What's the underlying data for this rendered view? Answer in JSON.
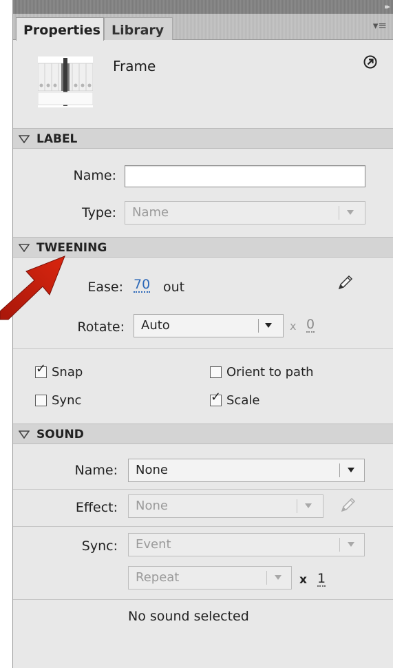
{
  "tabs": {
    "properties": "Properties",
    "library": "Library"
  },
  "header": {
    "title": "Frame"
  },
  "label_section": {
    "title": "LABEL",
    "name_label": "Name:",
    "name_value": "",
    "type_label": "Type:",
    "type_value": "Name"
  },
  "tweening_section": {
    "title": "TWEENING",
    "ease_label": "Ease:",
    "ease_value": "70",
    "ease_suffix": "out",
    "rotate_label": "Rotate:",
    "rotate_value": "Auto",
    "rotate_times_symbol": "x",
    "rotate_count": "0",
    "snap_label": "Snap",
    "snap_checked": true,
    "orient_label": "Orient to path",
    "orient_checked": false,
    "sync_label": "Sync",
    "sync_checked": false,
    "scale_label": "Scale",
    "scale_checked": true
  },
  "sound_section": {
    "title": "SOUND",
    "name_label": "Name:",
    "name_value": "None",
    "effect_label": "Effect:",
    "effect_value": "None",
    "sync_label": "Sync:",
    "sync_value": "Event",
    "repeat_value": "Repeat",
    "repeat_times_symbol": "x",
    "repeat_count": "1",
    "status": "No sound selected"
  },
  "colors": {
    "accent_link": "#2c68b8",
    "annotation_arrow": "#c81e0a"
  },
  "icons": [
    "collapse-icon",
    "panel-menu-icon",
    "frame-icon",
    "link-icon",
    "pencil-icon",
    "disclosure-triangle-icon",
    "checkmark-icon",
    "annotation-arrow"
  ]
}
